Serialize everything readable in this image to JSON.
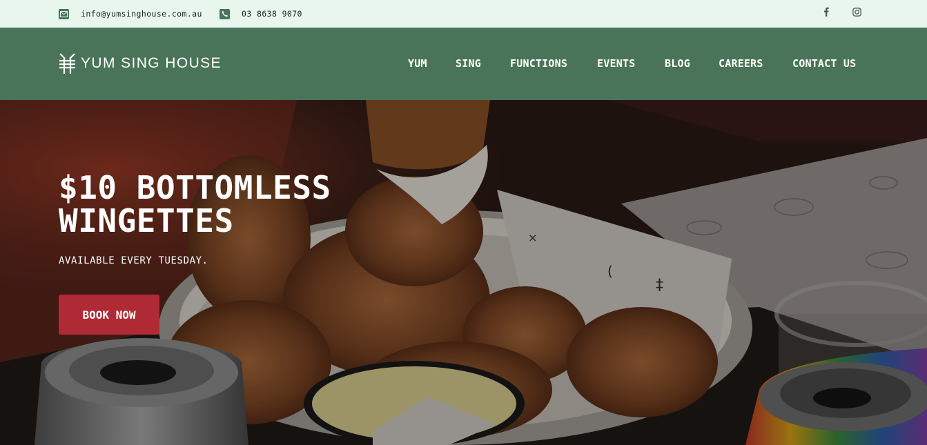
{
  "topbar": {
    "email": "info@yumsinghouse.com.au",
    "phone": "03 8638 9070",
    "icons": {
      "email": "envelope-icon",
      "phone": "phone-icon",
      "facebook": "facebook-icon",
      "instagram": "instagram-icon"
    }
  },
  "header": {
    "logo_text": "YUM SING HOUSE",
    "nav": [
      {
        "label": "YUM"
      },
      {
        "label": "SING"
      },
      {
        "label": "FUNCTIONS"
      },
      {
        "label": "EVENTS"
      },
      {
        "label": "BLOG"
      },
      {
        "label": "CAREERS"
      },
      {
        "label": "CONTACT US"
      }
    ]
  },
  "hero": {
    "title": "$10 BOTTOMLESS WINGETTES",
    "subtitle": "AVAILABLE EVERY TUESDAY.",
    "cta_label": "BOOK NOW"
  },
  "colors": {
    "topbar_bg": "#e8f6ee",
    "brand_green": "#4a7459",
    "cta_red": "#b02a35"
  }
}
